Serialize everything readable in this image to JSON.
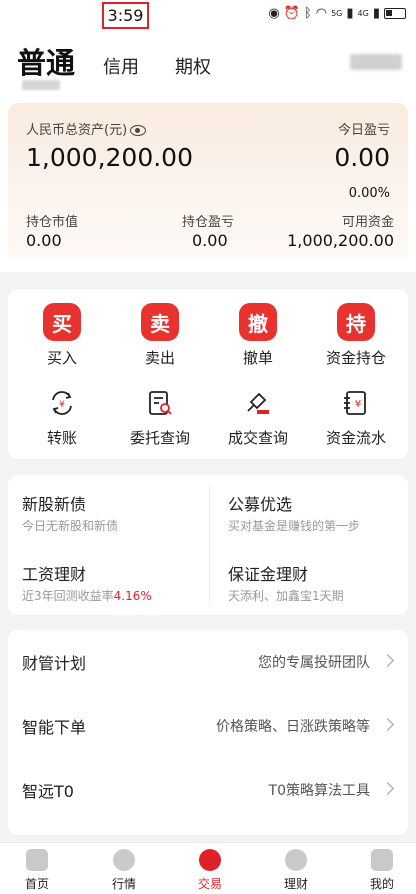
{
  "status_bar": {
    "time": "3:59",
    "network_1": "5G",
    "network_2": "4G"
  },
  "header": {
    "tabs": [
      {
        "label": "普通",
        "active": true
      },
      {
        "label": "信用"
      },
      {
        "label": "期权"
      }
    ]
  },
  "asset_card": {
    "total_assets_label": "人民币总资产(元)",
    "total_assets_value": "1,000,200.00",
    "today_pnl_label": "今日盈亏",
    "today_pnl_value": "0.00",
    "today_pnl_pct": "0.00%",
    "market_value_label": "持仓市值",
    "market_value": "0.00",
    "position_pnl_label": "持仓盈亏",
    "position_pnl": "0.00",
    "available_funds_label": "可用资金",
    "available_funds": "1,000,200.00"
  },
  "operations": [
    {
      "glyph": "买",
      "label": "买入"
    },
    {
      "glyph": "卖",
      "label": "卖出"
    },
    {
      "glyph": "撤",
      "label": "撤单"
    },
    {
      "glyph": "持",
      "label": "资金持仓"
    },
    {
      "icon": "transfer-icon",
      "label": "转账"
    },
    {
      "icon": "order-query-icon",
      "label": "委托查询"
    },
    {
      "icon": "deal-query-icon",
      "label": "成交查询"
    },
    {
      "icon": "fund-flow-icon",
      "label": "资金流水"
    }
  ],
  "finance": {
    "ipo": {
      "title": "新股新债",
      "subtitle": "今日无新股和新债"
    },
    "fund": {
      "title": "公募优选",
      "subtitle": "买对基金是赚钱的第一步"
    },
    "salary": {
      "title": "工资理财",
      "subtitle_prefix": "近3年回测收益率",
      "subtitle_rate": "4.16%"
    },
    "margin": {
      "title": "保证金理财",
      "subtitle": "天添利、加鑫宝1天期"
    }
  },
  "list": [
    {
      "title": "财管计划",
      "desc": "您的专属投研团队"
    },
    {
      "title": "智能下单",
      "desc": "价格策略、日涨跌策略等"
    },
    {
      "title": "智远T0",
      "desc": "T0策略算法工具"
    }
  ],
  "nav": [
    {
      "label": "首页"
    },
    {
      "label": "行情"
    },
    {
      "label": "交易",
      "active": true
    },
    {
      "label": "理财"
    },
    {
      "label": "我的"
    }
  ],
  "colors": {
    "accent": "#e0212a",
    "badge": "#e8322f"
  }
}
